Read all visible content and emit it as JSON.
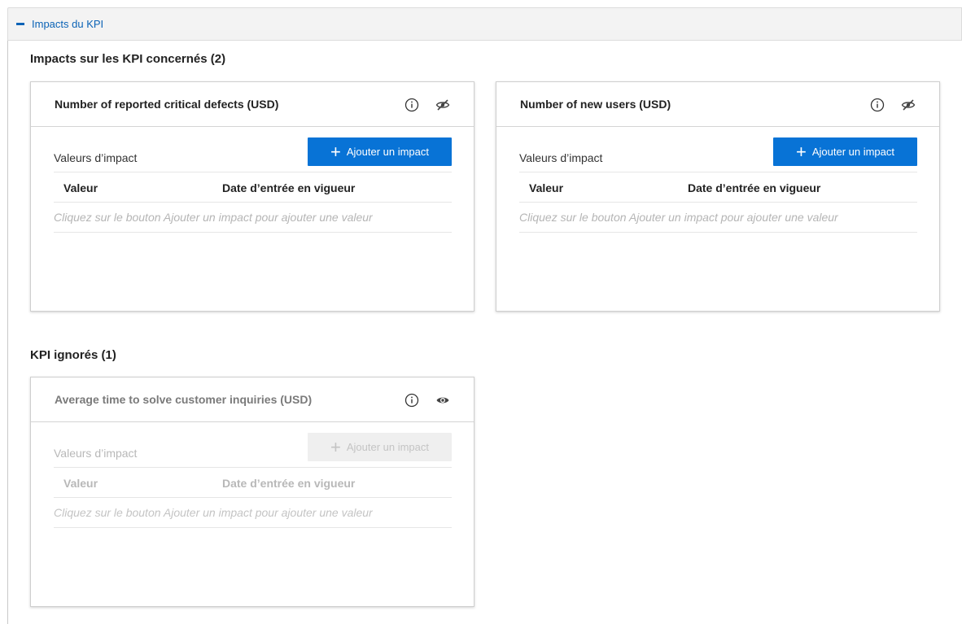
{
  "section": {
    "title": "Impacts du KPI"
  },
  "concerned": {
    "heading": "Impacts sur les KPI concernés (2)",
    "cards": [
      {
        "title": "Number of reported critical defects (USD)",
        "impact_values_label": "Valeurs d’impact",
        "add_button_label": "Ajouter un impact",
        "col_value": "Valeur",
        "col_date": "Date d’entrée en vigueur",
        "empty_message": "Cliquez sur le bouton Ajouter un impact pour ajouter une valeur"
      },
      {
        "title": "Number of new users (USD)",
        "impact_values_label": "Valeurs d’impact",
        "add_button_label": "Ajouter un impact",
        "col_value": "Valeur",
        "col_date": "Date d’entrée en vigueur",
        "empty_message": "Cliquez sur le bouton Ajouter un impact pour ajouter une valeur"
      }
    ]
  },
  "ignored": {
    "heading": "KPI ignorés (1)",
    "cards": [
      {
        "title": "Average time to solve customer inquiries (USD)",
        "impact_values_label": "Valeurs d’impact",
        "add_button_label": "Ajouter un impact",
        "col_value": "Valeur",
        "col_date": "Date d’entrée en vigueur",
        "empty_message": "Cliquez sur le bouton Ajouter un impact pour ajouter une valeur"
      }
    ]
  },
  "icons": {
    "collapse": "minus-icon",
    "info": "info-icon",
    "hide": "eye-slash-icon",
    "show": "eye-icon",
    "add": "plus-icon"
  },
  "colors": {
    "accent": "#0873d6",
    "header_text": "#0b63b6",
    "disabled_text": "#b8b8b8"
  }
}
